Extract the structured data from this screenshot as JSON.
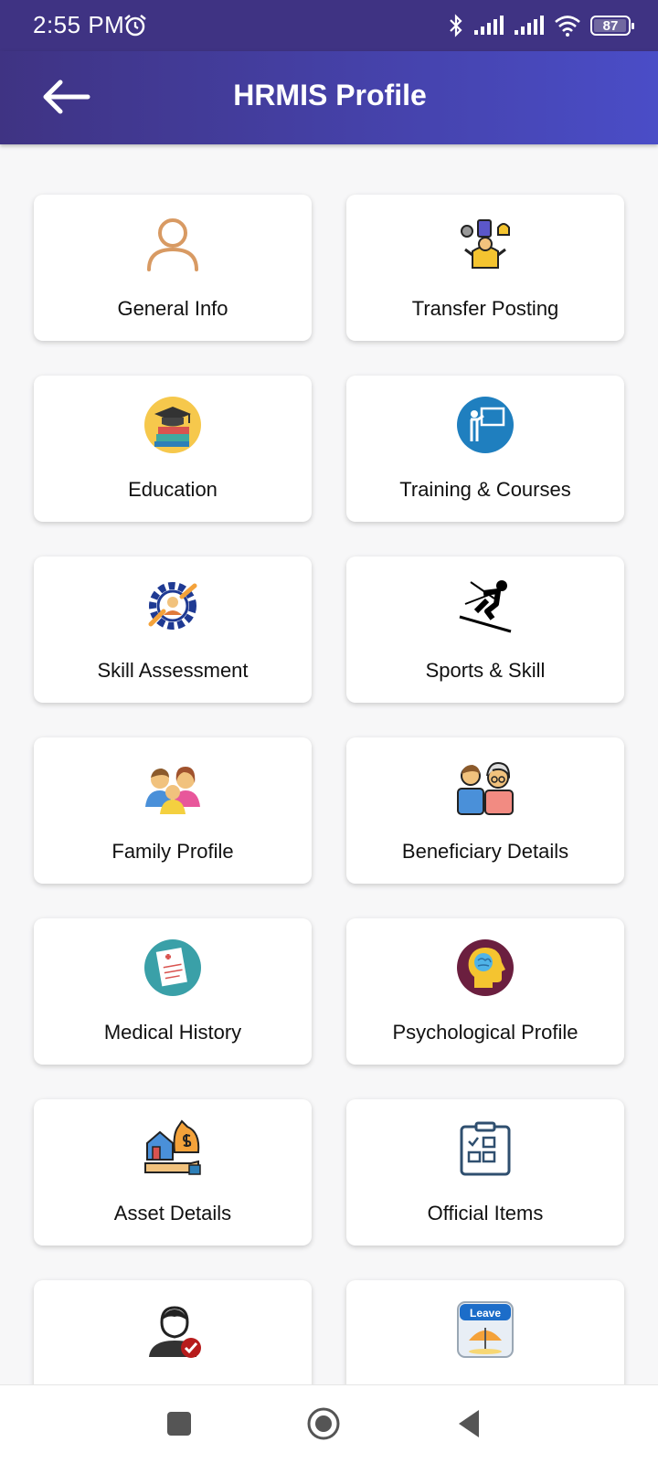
{
  "status": {
    "time": "2:55 PM",
    "battery": "87"
  },
  "appbar": {
    "title": "HRMIS Profile"
  },
  "tiles": [
    {
      "label": "General Info",
      "icon": "person-icon"
    },
    {
      "label": "Transfer Posting",
      "icon": "transfer-posting-icon"
    },
    {
      "label": "Education",
      "icon": "education-icon"
    },
    {
      "label": "Training & Courses",
      "icon": "training-icon"
    },
    {
      "label": "Skill Assessment",
      "icon": "gear-person-icon"
    },
    {
      "label": "Sports & Skill",
      "icon": "skier-icon"
    },
    {
      "label": "Family Profile",
      "icon": "family-icon"
    },
    {
      "label": "Beneficiary Details",
      "icon": "beneficiary-icon"
    },
    {
      "label": "Medical History",
      "icon": "medical-report-icon"
    },
    {
      "label": "Psychological Profile",
      "icon": "brain-head-icon"
    },
    {
      "label": "Asset Details",
      "icon": "asset-icon"
    },
    {
      "label": "Official Items",
      "icon": "clipboard-icon"
    },
    {
      "label": "",
      "icon": "user-check-icon"
    },
    {
      "label": "",
      "icon": "leave-calendar-icon",
      "badge": "Leave"
    }
  ]
}
